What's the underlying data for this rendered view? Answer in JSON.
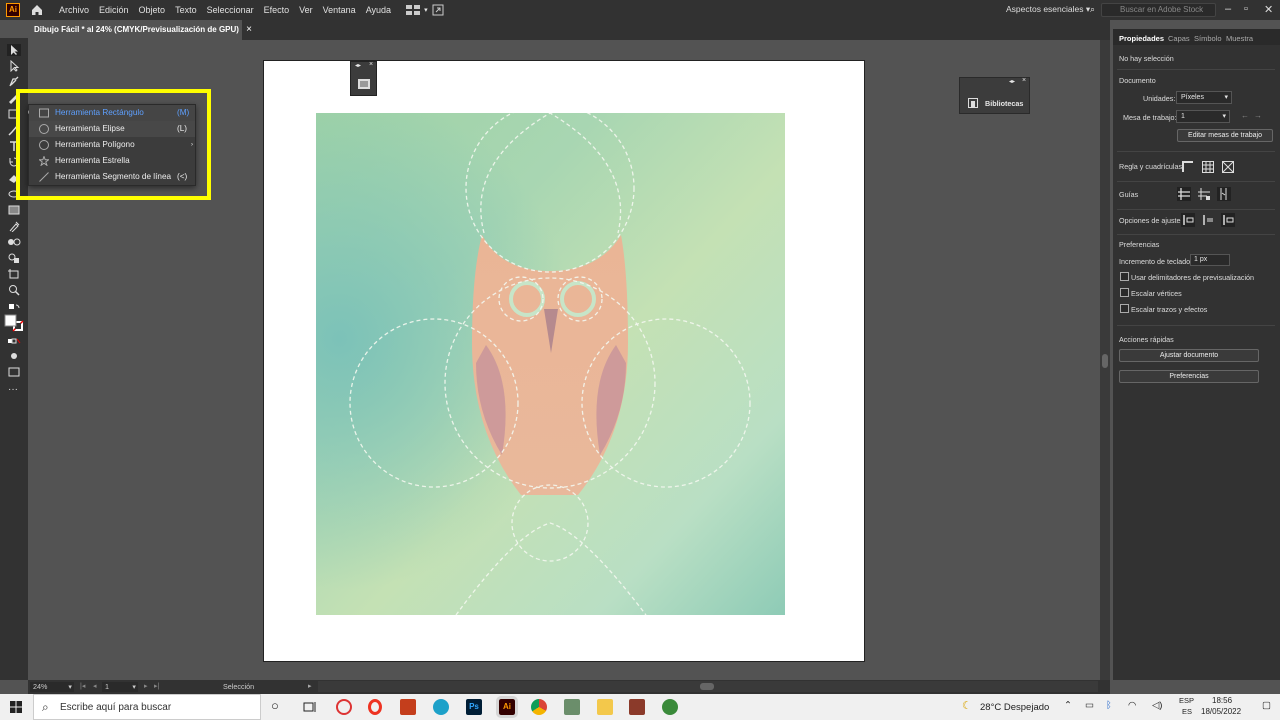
{
  "app": {
    "logo": "Ai"
  },
  "menu": [
    "Archivo",
    "Edición",
    "Objeto",
    "Texto",
    "Seleccionar",
    "Efecto",
    "Ver",
    "Ventana",
    "Ayuda"
  ],
  "workspace": "Aspectos esenciales",
  "stock_placeholder": "Buscar en Adobe Stock",
  "doc_tab": {
    "title": "Dibujo Fácil * al 24% (CMYK/Previsualización de GPU)",
    "close": "×"
  },
  "flyout": [
    {
      "label": "Herramienta Rectángulo",
      "shortcut": "(M)"
    },
    {
      "label": "Herramienta Elipse",
      "shortcut": "(L)"
    },
    {
      "label": "Herramienta Polígono",
      "shortcut": ""
    },
    {
      "label": "Herramienta Estrella",
      "shortcut": ""
    },
    {
      "label": "Herramienta Segmento de línea",
      "shortcut": "(<)"
    }
  ],
  "libraries": "Bibliotecas",
  "panel": {
    "tabs": [
      "Propiedades",
      "Capas",
      "Símbolo",
      "Muestra"
    ],
    "no_selection": "No hay selección",
    "document": "Documento",
    "units_label": "Unidades:",
    "units_value": "Píxeles",
    "artboard_label": "Mesa de trabajo:",
    "artboard_value": "1",
    "edit_artboards": "Editar mesas de trabajo",
    "rulers": "Regla y cuadrículas",
    "guides": "Guías",
    "snap": "Opciones de ajuste",
    "prefs": "Preferencias",
    "key_inc_label": "Incremento de teclado:",
    "key_inc_value": "1 px",
    "checks": [
      "Usar delimitadores de previsualización",
      "Escalar vértices",
      "Escalar trazos y efectos"
    ],
    "quick_actions": "Acciones rápidas",
    "fit_doc": "Ajustar documento",
    "prefs_btn": "Preferencias"
  },
  "status": {
    "zoom": "24%",
    "artboard": "1",
    "tool": "Selección"
  },
  "taskbar": {
    "search": "Escribe aquí para buscar",
    "weather": "28°C  Despejado",
    "lang1": "ESP",
    "lang2": "ES",
    "time": "18:56",
    "date": "18/05/2022"
  }
}
